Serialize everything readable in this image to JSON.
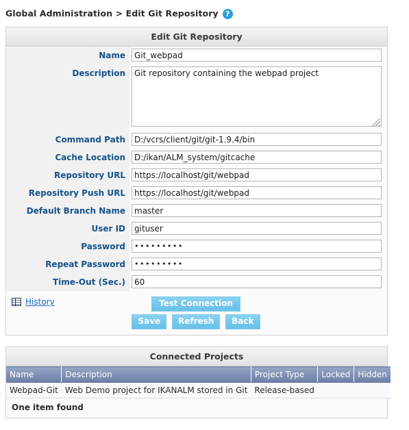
{
  "breadcrumb": {
    "text": "Global Administration > Edit Git Repository",
    "help_icon": "help-icon",
    "help_glyph": "?"
  },
  "form_panel": {
    "title": "Edit Git Repository",
    "fields": [
      {
        "label": "Name",
        "value": "Git_webpad",
        "type": "text"
      },
      {
        "label": "Description",
        "value": "Git repository containing the webpad project",
        "type": "textarea"
      },
      {
        "label": "Command Path",
        "value": "D:/vcrs/client/git/git-1.9.4/bin",
        "type": "text"
      },
      {
        "label": "Cache Location",
        "value": "D:/ikan/ALM_system/gitcache",
        "type": "text"
      },
      {
        "label": "Repository URL",
        "value": "https://localhost/git/webpad",
        "type": "text"
      },
      {
        "label": "Repository Push URL",
        "value": "https://localhost/git/webpad",
        "type": "text"
      },
      {
        "label": "Default Branch Name",
        "value": "master",
        "type": "text"
      },
      {
        "label": "User ID",
        "value": "gituser",
        "type": "text"
      },
      {
        "label": "Password",
        "value": "•••••••••",
        "type": "password"
      },
      {
        "label": "Repeat Password",
        "value": "•••••••••",
        "type": "password"
      },
      {
        "label": "Time-Out (Sec.)",
        "value": "60",
        "type": "text"
      }
    ],
    "history": {
      "label": "History",
      "icon": "table-history-icon"
    },
    "buttons": {
      "test_connection": "Test Connection",
      "save": "Save",
      "refresh": "Refresh",
      "back": "Back"
    }
  },
  "projects_panel": {
    "title": "Connected Projects",
    "columns": [
      "Name",
      "Description",
      "Project Type",
      "Locked",
      "Hidden"
    ],
    "rows": [
      {
        "name": "Webpad-Git",
        "description": "Web Demo project for IKANALM stored in Git",
        "project_type": "Release-based",
        "locked": "",
        "hidden": ""
      }
    ],
    "footer": "One item found"
  },
  "colors": {
    "label_text": "#14538b",
    "button_blue": "#72c6eb",
    "table_header": "#8293b6",
    "link_blue": "#1565c0"
  }
}
